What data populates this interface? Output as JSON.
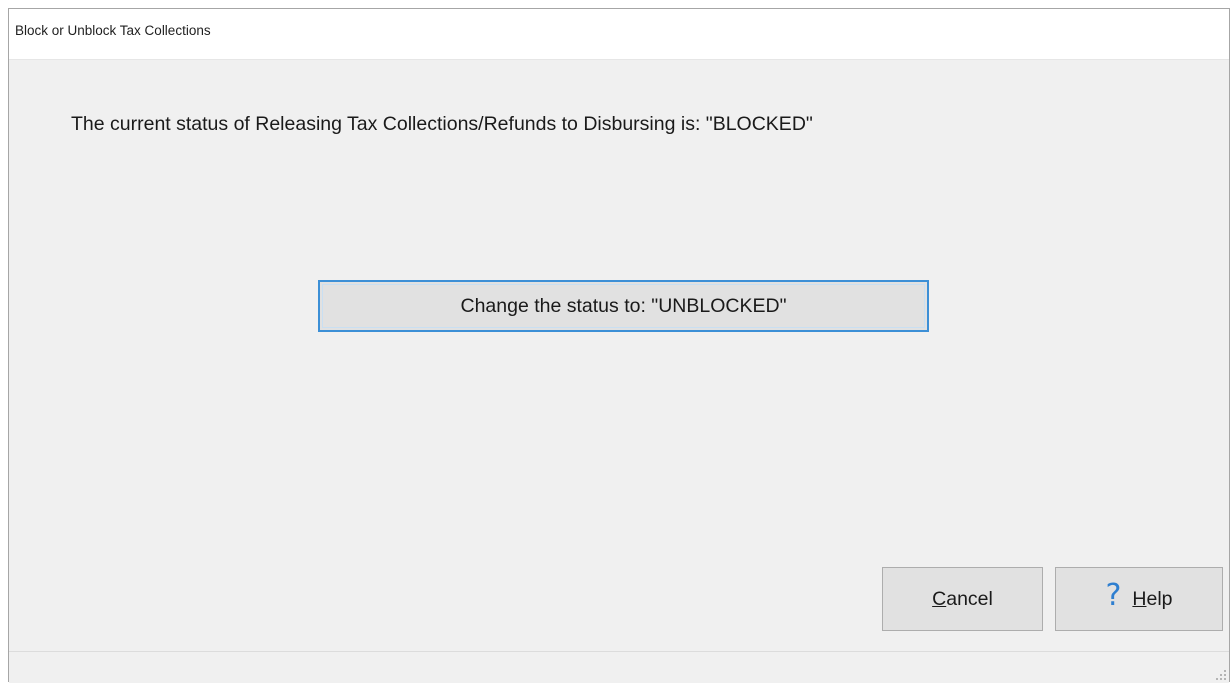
{
  "window": {
    "title": "Block or Unblock Tax Collections"
  },
  "dialog": {
    "status_message": "The current status of Releasing Tax Collections/Refunds to Disbursing is: \"BLOCKED\"",
    "change_button_label": "Change the status to: \"UNBLOCKED\""
  },
  "buttons": {
    "cancel": {
      "accel": "C",
      "rest": "ancel"
    },
    "help": {
      "icon": "question-mark-icon",
      "accel": "H",
      "rest": "elp"
    }
  },
  "colors": {
    "focus_border": "#3c8fd6",
    "help_icon": "#2f7fd0",
    "dialog_background": "#f0f0f0"
  }
}
